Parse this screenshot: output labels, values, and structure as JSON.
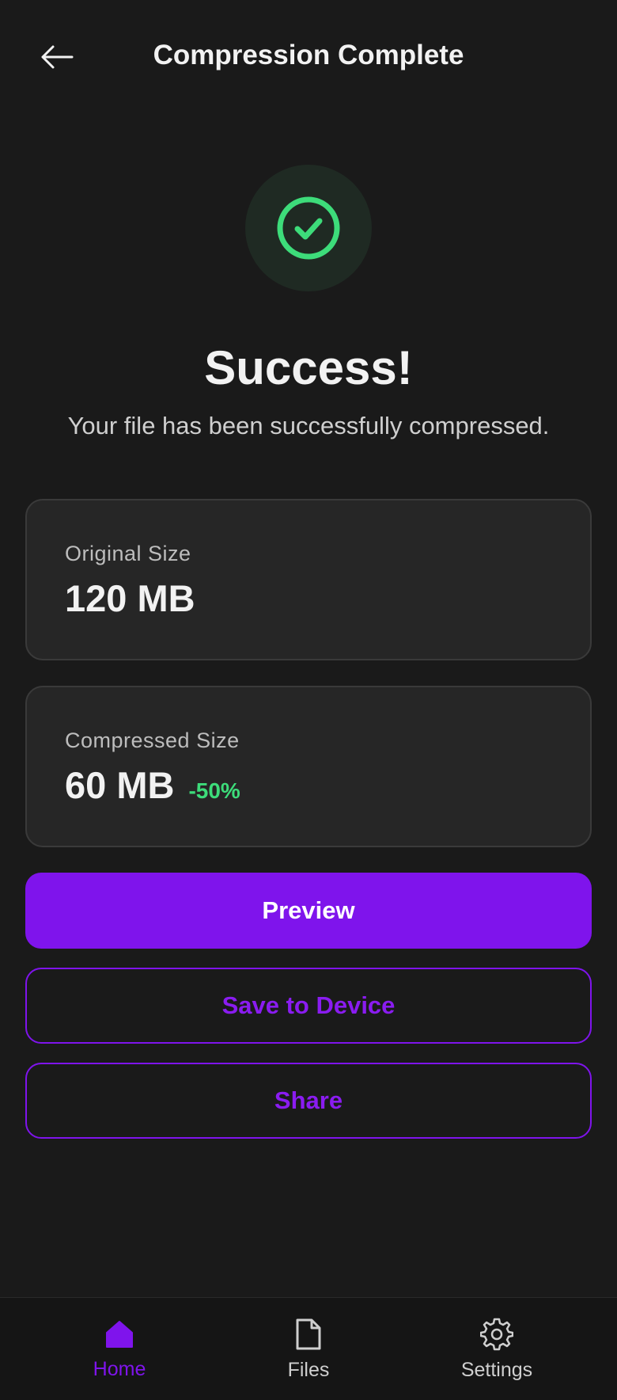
{
  "header": {
    "title": "Compression Complete",
    "back_icon": "arrow-left-icon"
  },
  "status": {
    "icon": "check-circle-icon",
    "icon_color": "#3ddc7a",
    "heading": "Success!",
    "message": "Your file has been successfully compressed."
  },
  "original": {
    "label": "Original Size",
    "value": "120 MB"
  },
  "compressed": {
    "label": "Compressed Size",
    "value": "60 MB",
    "delta": "-50%"
  },
  "actions": {
    "preview": "Preview",
    "save": "Save to Device",
    "share": "Share"
  },
  "nav": {
    "items": [
      {
        "label": "Home",
        "icon": "home-icon",
        "active": true
      },
      {
        "label": "Files",
        "icon": "file-icon",
        "active": false
      },
      {
        "label": "Settings",
        "icon": "gear-icon",
        "active": false
      }
    ]
  },
  "colors": {
    "background": "#1a1a1a",
    "accent": "#7f14ec",
    "success": "#3ddc7a"
  }
}
